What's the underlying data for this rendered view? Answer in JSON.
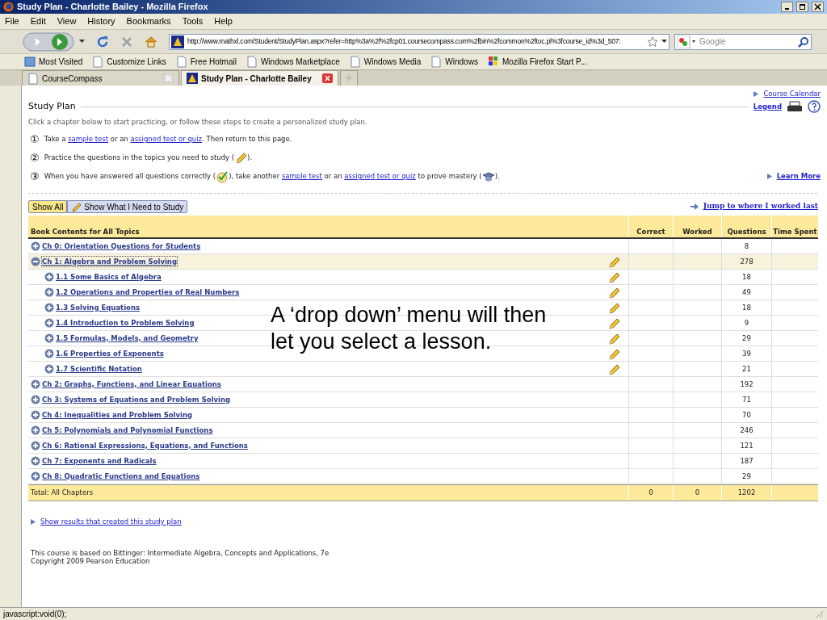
{
  "window": {
    "title": "Study Plan - Charlotte Bailey - Mozilla Firefox"
  },
  "menu": [
    "File",
    "Edit",
    "View",
    "History",
    "Bookmarks",
    "Tools",
    "Help"
  ],
  "address": {
    "value": "http://www.mathxl.com/Student/StudyPlan.aspx?refer=http%3a%2f%2fcp01.coursecompass.com%2fbin%2fcommon%2ftoc.pl%3fcourse_id%3d_507:"
  },
  "search": {
    "placeholder": "Google"
  },
  "bookmarks": [
    "Most Visited",
    "Customize Links",
    "Free Hotmail",
    "Windows Marketplace",
    "Windows Media",
    "Windows",
    "Mozilla Firefox Start P..."
  ],
  "tabs": [
    {
      "label": "CourseCompass",
      "selected": false
    },
    {
      "label": "Study Plan - Charlotte Bailey",
      "selected": true
    }
  ],
  "page": {
    "course_calendar": "Course Calendar",
    "legend": "Legend",
    "title": "Study Plan",
    "intro": "Click a chapter below to start practicing, or follow these steps to create a personalized study plan.",
    "steps": [
      {
        "number": "①",
        "parts": [
          {
            "kind": "text",
            "text": "Take a "
          },
          {
            "kind": "link",
            "text": "sample test"
          },
          {
            "kind": "text",
            "text": " or an "
          },
          {
            "kind": "link",
            "text": "assigned test or quiz"
          },
          {
            "kind": "text",
            "text": ". Then return to this page."
          }
        ]
      },
      {
        "number": "②",
        "parts": [
          {
            "kind": "text",
            "text": "Practice the questions in the topics you need to study ("
          },
          {
            "kind": "pencil"
          },
          {
            "kind": "text",
            "text": ")."
          }
        ]
      },
      {
        "number": "③",
        "parts": [
          {
            "kind": "text",
            "text": "When you have answered all questions correctly ("
          },
          {
            "kind": "check"
          },
          {
            "kind": "text",
            "text": "), take another "
          },
          {
            "kind": "link",
            "text": "sample test"
          },
          {
            "kind": "text",
            "text": " or an "
          },
          {
            "kind": "link",
            "text": "assigned test or quiz"
          },
          {
            "kind": "text",
            "text": " to prove mastery ("
          },
          {
            "kind": "cap"
          },
          {
            "kind": "text",
            "text": ")."
          }
        ]
      }
    ],
    "learn_more": "Learn More",
    "filters": [
      {
        "label": "Show All",
        "selected": true
      },
      {
        "label": "Show What I Need to Study",
        "selected": false
      }
    ],
    "jump": "Jump to where I worked last",
    "table": {
      "columns": [
        "Book Contents for All Topics",
        "Correct",
        "Worked",
        "Questions",
        "Time Spent"
      ],
      "rows": [
        {
          "title": "Ch 0: Orientation Questions for Students",
          "questions": "8",
          "expanded": false,
          "selected": false,
          "study": false
        },
        {
          "title": "Ch 1: Algebra and Problem Solving",
          "questions": "278",
          "expanded": true,
          "selected": true,
          "study": true,
          "children": [
            {
              "title": "1.1 Some Basics of Algebra",
              "questions": "18",
              "study": true
            },
            {
              "title": "1.2 Operations and Properties of Real Numbers",
              "questions": "49",
              "study": true
            },
            {
              "title": "1.3 Solving Equations",
              "questions": "18",
              "study": true
            },
            {
              "title": "1.4 Introduction to Problem Solving",
              "questions": "9",
              "study": true
            },
            {
              "title": "1.5 Formulas, Models, and Geometry",
              "questions": "29",
              "study": true
            },
            {
              "title": "1.6 Properties of Exponents",
              "questions": "39",
              "study": true
            },
            {
              "title": "1.7 Scientific Notation",
              "questions": "21",
              "study": true
            }
          ]
        },
        {
          "title": "Ch 2: Graphs, Functions, and Linear Equations",
          "questions": "192",
          "expanded": false,
          "selected": false,
          "study": false
        },
        {
          "title": "Ch 3: Systems of Equations and Problem Solving",
          "questions": "71",
          "expanded": false,
          "selected": false,
          "study": false
        },
        {
          "title": "Ch 4: Inequalities and Problem Solving",
          "questions": "70",
          "expanded": false,
          "selected": false,
          "study": false
        },
        {
          "title": "Ch 5: Polynomials and Polynomial Functions",
          "questions": "246",
          "expanded": false,
          "selected": false,
          "study": false
        },
        {
          "title": "Ch 6: Rational Expressions, Equations, and Functions",
          "questions": "121",
          "expanded": false,
          "selected": false,
          "study": false
        },
        {
          "title": "Ch 7: Exponents and Radicals",
          "questions": "187",
          "expanded": false,
          "selected": false,
          "study": false
        },
        {
          "title": "Ch 8: Quadratic Functions and Equations",
          "questions": "29",
          "expanded": false,
          "selected": false,
          "study": false
        }
      ],
      "total": {
        "label": "Total: All Chapters",
        "correct": "0",
        "worked": "0",
        "questions": "1202"
      }
    },
    "show_results": "Show results that created this study plan",
    "footer": [
      "This course is based on Bittinger: Intermediate Algebra, Concepts and Applications, 7e",
      "Copyright 2009 Pearson Education"
    ],
    "overlay": "A ‘drop down’ menu will then let you select a lesson."
  },
  "status_bar": "javascript:void(0);"
}
